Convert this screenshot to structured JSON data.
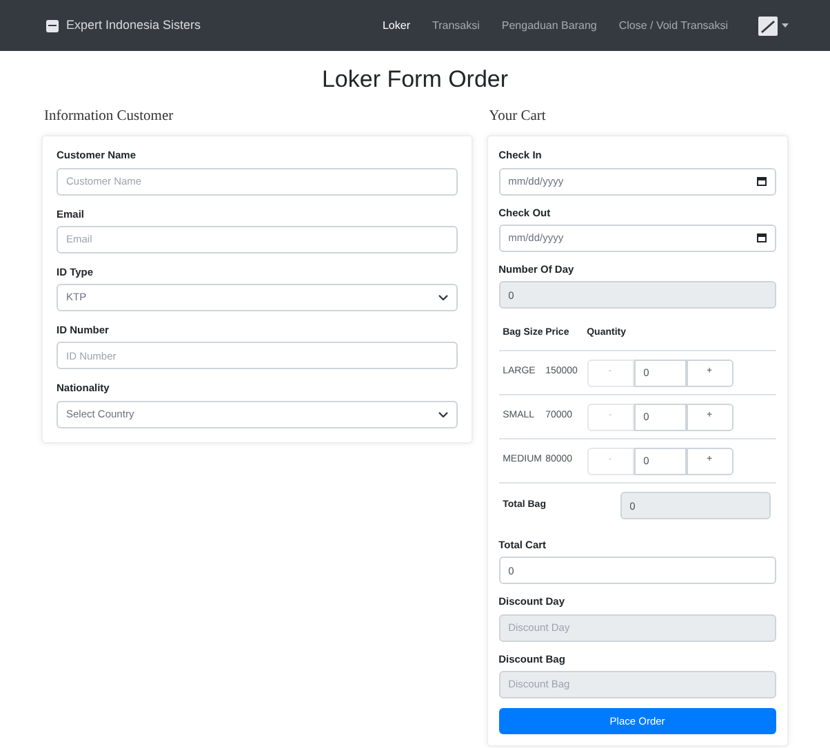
{
  "navbar": {
    "brand": "Expert Indonesia Sisters",
    "links": [
      {
        "label": "Loker",
        "selected": true
      },
      {
        "label": "Transaksi",
        "selected": false
      },
      {
        "label": "Pengaduan Barang",
        "selected": false
      },
      {
        "label": "Close / Void Transaksi",
        "selected": false
      }
    ]
  },
  "title": "Loker Form Order",
  "customer": {
    "heading": "Information Customer",
    "fields": [
      {
        "kind": "input",
        "label": "Customer Name",
        "placeholder": "Customer Name"
      },
      {
        "kind": "input",
        "label": "Email",
        "placeholder": "Email"
      },
      {
        "kind": "select",
        "label": "ID Type",
        "value": "KTP"
      },
      {
        "kind": "input",
        "label": "ID Number",
        "placeholder": "ID Number"
      },
      {
        "kind": "select",
        "label": "Nationality",
        "value": "Select Country"
      }
    ]
  },
  "cart": {
    "heading": "Your Cart",
    "dates": [
      {
        "label": "Check In",
        "placeholder": "mm/dd/yyyy"
      },
      {
        "label": "Check Out",
        "placeholder": "mm/dd/yyyy"
      }
    ],
    "number_of_day": {
      "label": "Number Of Day",
      "value": "0"
    },
    "table": {
      "columns": [
        "Bag Size",
        "Price",
        "Quantity"
      ],
      "rows": [
        {
          "size": "LARGE",
          "price": "150000",
          "minus": "-",
          "quantity": "0",
          "plus": "+"
        },
        {
          "size": "SMALL",
          "price": "70000",
          "minus": "-",
          "quantity": "0",
          "plus": "+"
        },
        {
          "size": "MEDIUM",
          "price": "80000",
          "minus": "-",
          "quantity": "0",
          "plus": "+"
        }
      ],
      "total_bag": {
        "label": "Total Bag",
        "value": "0"
      }
    },
    "total_cart": {
      "label": "Total Cart",
      "value": "0"
    },
    "discount_day": {
      "label": "Discount Day",
      "placeholder": "Discount Day"
    },
    "discount_bag": {
      "label": "Discount Bag",
      "placeholder": "Discount Bag"
    },
    "button": "Place Order"
  }
}
